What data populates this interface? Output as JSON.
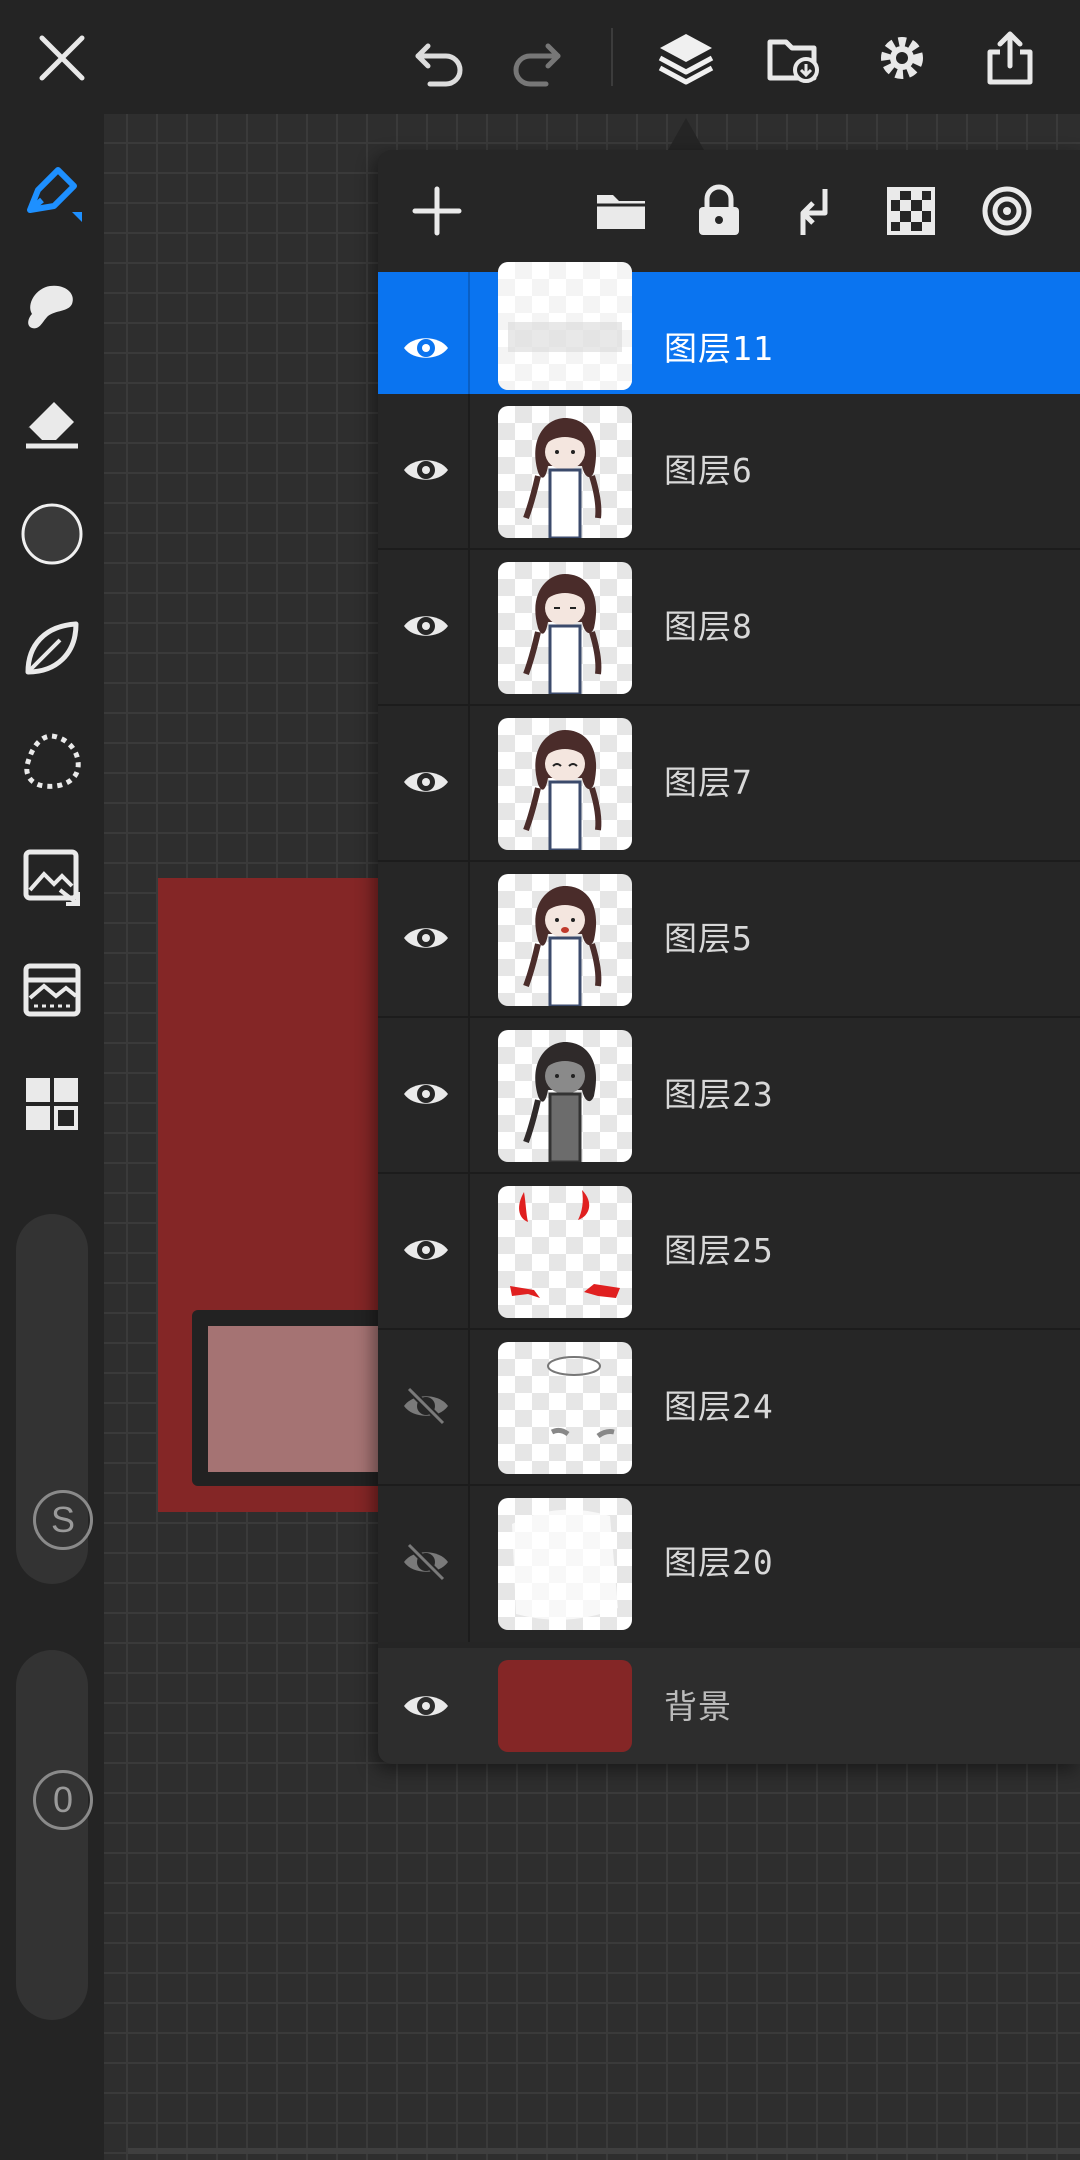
{
  "toolbar": {
    "icons": [
      "close-icon",
      "undo-icon",
      "redo-icon",
      "layers-icon",
      "gallery-icon",
      "settings-icon",
      "share-icon"
    ]
  },
  "left_tools": {
    "icons": [
      "pen-icon",
      "smudge-icon",
      "eraser-icon",
      "color-icon",
      "leaf-brush-icon",
      "lasso-icon",
      "image-import-icon",
      "filter-icon",
      "grid-icon"
    ],
    "color_swatch": "#3a3a3a",
    "size_slider_label": "S",
    "opacity_slider_label": "0"
  },
  "canvas": {
    "fill_color": "#842626",
    "overlay_color": "#a57373"
  },
  "layers_panel": {
    "header_icons": [
      "add-layer-icon",
      "folder-icon",
      "lock-icon",
      "merge-down-icon",
      "transparency-icon",
      "blend-icon"
    ],
    "layers": [
      {
        "name": "图层11",
        "visible": true,
        "selected": true
      },
      {
        "name": "图层6",
        "visible": true,
        "selected": false
      },
      {
        "name": "图层8",
        "visible": true,
        "selected": false
      },
      {
        "name": "图层7",
        "visible": true,
        "selected": false
      },
      {
        "name": "图层5",
        "visible": true,
        "selected": false
      },
      {
        "name": "图层23",
        "visible": true,
        "selected": false
      },
      {
        "name": "图层25",
        "visible": true,
        "selected": false
      },
      {
        "name": "图层24",
        "visible": false,
        "selected": false
      },
      {
        "name": "图层20",
        "visible": false,
        "selected": false
      }
    ],
    "background_layer": {
      "name": "背景",
      "visible": true,
      "color": "#842626"
    },
    "accent_color": "#0a74f0"
  }
}
